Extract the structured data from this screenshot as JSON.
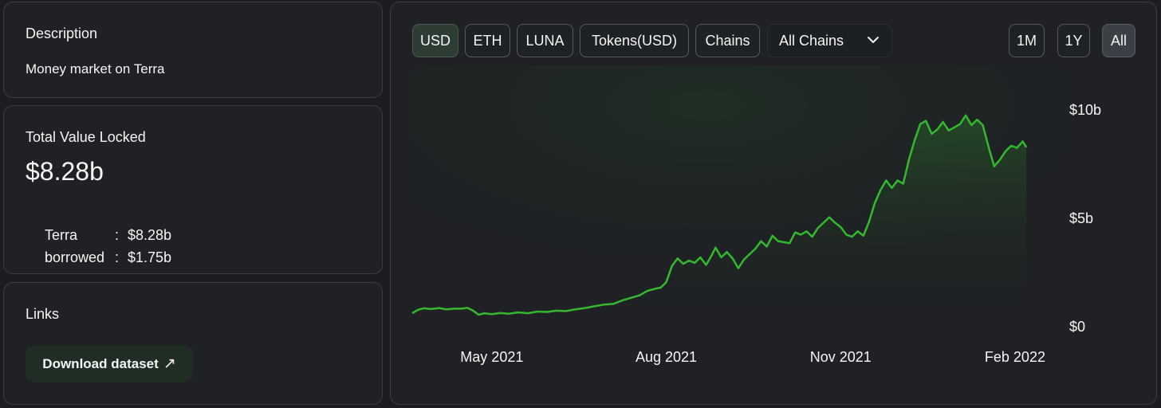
{
  "description": {
    "title": "Description",
    "text": "Money market on Terra"
  },
  "tvl": {
    "title": "Total Value Locked",
    "value": "$8.28b",
    "rows": [
      {
        "key": "Terra",
        "sep": ":",
        "value": "$8.28b"
      },
      {
        "key": "borrowed",
        "sep": ":",
        "value": "$1.75b"
      }
    ]
  },
  "links": {
    "title": "Links",
    "download_label": "Download dataset",
    "download_icon": "↗"
  },
  "toolbar": {
    "denominations": [
      "USD",
      "ETH",
      "LUNA",
      "Tokens(USD)",
      "Chains"
    ],
    "active_denomination": "USD",
    "chain_select": "All Chains",
    "ranges": [
      "1M",
      "1Y",
      "All"
    ],
    "active_range": "All"
  },
  "colors": {
    "line": "#35b82f",
    "accent_bg": "#2d3d34"
  },
  "chart_data": {
    "type": "area",
    "title": "",
    "xlabel": "",
    "ylabel": "",
    "x_ticks": [
      "May 2021",
      "Aug 2021",
      "Nov 2021",
      "Feb 2022"
    ],
    "y_ticks": [
      "$0",
      "$5b",
      "$10b"
    ],
    "y_tick_values": [
      0,
      5,
      10
    ],
    "ylim": [
      0,
      10
    ],
    "x_range": [
      "2021-03-20",
      "2022-02-25"
    ],
    "grid": false,
    "legend": "none",
    "series": [
      {
        "unit": "USD billions",
        "points": [
          [
            "2021-03-20",
            0.62
          ],
          [
            "2021-03-23",
            0.78
          ],
          [
            "2021-03-26",
            0.85
          ],
          [
            "2021-03-30",
            0.82
          ],
          [
            "2021-04-03",
            0.86
          ],
          [
            "2021-04-07",
            0.8
          ],
          [
            "2021-04-11",
            0.84
          ],
          [
            "2021-04-15",
            0.83
          ],
          [
            "2021-04-18",
            0.87
          ],
          [
            "2021-04-21",
            0.75
          ],
          [
            "2021-04-24",
            0.55
          ],
          [
            "2021-04-27",
            0.62
          ],
          [
            "2021-05-01",
            0.58
          ],
          [
            "2021-05-05",
            0.63
          ],
          [
            "2021-05-10",
            0.6
          ],
          [
            "2021-05-15",
            0.66
          ],
          [
            "2021-05-20",
            0.62
          ],
          [
            "2021-05-25",
            0.7
          ],
          [
            "2021-05-30",
            0.68
          ],
          [
            "2021-06-04",
            0.74
          ],
          [
            "2021-06-09",
            0.72
          ],
          [
            "2021-06-14",
            0.8
          ],
          [
            "2021-06-19",
            0.86
          ],
          [
            "2021-06-24",
            0.94
          ],
          [
            "2021-06-29",
            1.02
          ],
          [
            "2021-07-04",
            1.05
          ],
          [
            "2021-07-09",
            1.22
          ],
          [
            "2021-07-14",
            1.35
          ],
          [
            "2021-07-18",
            1.45
          ],
          [
            "2021-07-22",
            1.65
          ],
          [
            "2021-07-26",
            1.75
          ],
          [
            "2021-07-29",
            1.8
          ],
          [
            "2021-08-01",
            2.05
          ],
          [
            "2021-08-04",
            2.8
          ],
          [
            "2021-08-07",
            3.15
          ],
          [
            "2021-08-10",
            2.9
          ],
          [
            "2021-08-13",
            3.05
          ],
          [
            "2021-08-16",
            2.95
          ],
          [
            "2021-08-19",
            3.2
          ],
          [
            "2021-08-22",
            2.85
          ],
          [
            "2021-08-25",
            3.3
          ],
          [
            "2021-08-27",
            3.65
          ],
          [
            "2021-08-30",
            3.2
          ],
          [
            "2021-09-02",
            3.45
          ],
          [
            "2021-09-05",
            3.15
          ],
          [
            "2021-09-08",
            2.7
          ],
          [
            "2021-09-11",
            3.1
          ],
          [
            "2021-09-14",
            3.35
          ],
          [
            "2021-09-17",
            3.6
          ],
          [
            "2021-09-20",
            3.95
          ],
          [
            "2021-09-23",
            3.7
          ],
          [
            "2021-09-26",
            4.2
          ],
          [
            "2021-09-29",
            3.95
          ],
          [
            "2021-10-02",
            3.9
          ],
          [
            "2021-10-05",
            3.85
          ],
          [
            "2021-10-08",
            4.35
          ],
          [
            "2021-10-11",
            4.25
          ],
          [
            "2021-10-14",
            4.4
          ],
          [
            "2021-10-17",
            4.15
          ],
          [
            "2021-10-20",
            4.55
          ],
          [
            "2021-10-23",
            4.8
          ],
          [
            "2021-10-26",
            5.05
          ],
          [
            "2021-10-29",
            4.8
          ],
          [
            "2021-11-01",
            4.6
          ],
          [
            "2021-11-04",
            4.25
          ],
          [
            "2021-11-07",
            4.15
          ],
          [
            "2021-11-10",
            4.4
          ],
          [
            "2021-11-13",
            4.2
          ],
          [
            "2021-11-16",
            4.85
          ],
          [
            "2021-11-19",
            5.7
          ],
          [
            "2021-11-22",
            6.3
          ],
          [
            "2021-11-25",
            6.75
          ],
          [
            "2021-11-28",
            6.4
          ],
          [
            "2021-12-01",
            6.75
          ],
          [
            "2021-12-04",
            6.6
          ],
          [
            "2021-12-07",
            7.7
          ],
          [
            "2021-12-10",
            8.6
          ],
          [
            "2021-12-13",
            9.35
          ],
          [
            "2021-12-16",
            9.5
          ],
          [
            "2021-12-19",
            8.9
          ],
          [
            "2021-12-22",
            9.1
          ],
          [
            "2021-12-25",
            9.45
          ],
          [
            "2021-12-28",
            9.05
          ],
          [
            "2021-12-31",
            9.2
          ],
          [
            "2022-01-03",
            9.35
          ],
          [
            "2022-01-06",
            9.75
          ],
          [
            "2022-01-09",
            9.3
          ],
          [
            "2022-01-12",
            9.55
          ],
          [
            "2022-01-15",
            9.3
          ],
          [
            "2022-01-18",
            8.3
          ],
          [
            "2022-01-21",
            7.4
          ],
          [
            "2022-01-24",
            7.7
          ],
          [
            "2022-01-27",
            8.1
          ],
          [
            "2022-01-30",
            8.35
          ],
          [
            "2022-02-02",
            8.25
          ],
          [
            "2022-02-05",
            8.55
          ],
          [
            "2022-02-07",
            8.28
          ]
        ]
      }
    ]
  }
}
